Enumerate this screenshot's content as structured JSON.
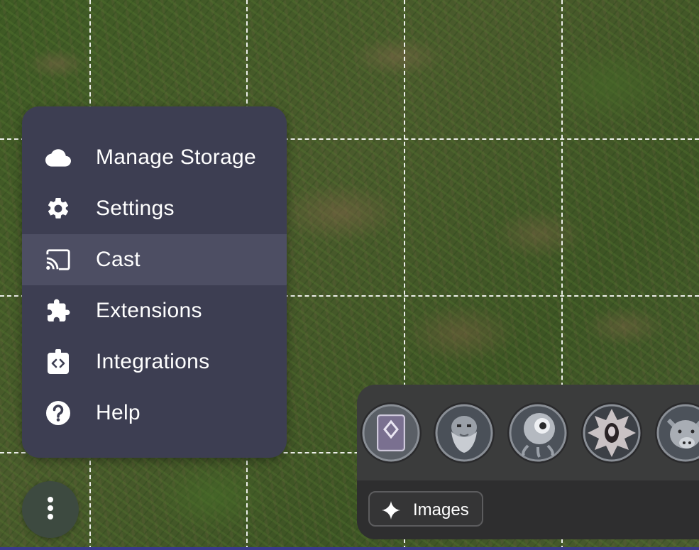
{
  "menu": {
    "items": [
      {
        "label": "Manage Storage",
        "icon": "cloud-icon",
        "active": false
      },
      {
        "label": "Settings",
        "icon": "gear-icon",
        "active": false
      },
      {
        "label": "Cast",
        "icon": "cast-icon",
        "active": true
      },
      {
        "label": "Extensions",
        "icon": "puzzle-piece-icon",
        "active": false
      },
      {
        "label": "Integrations",
        "icon": "integrations-icon",
        "active": false
      },
      {
        "label": "Help",
        "icon": "help-circle-icon",
        "active": false
      }
    ]
  },
  "fab": {
    "icon": "more-vertical-icon"
  },
  "tray": {
    "tokens": [
      {
        "icon": "spellbook-token"
      },
      {
        "icon": "dwarf-token"
      },
      {
        "icon": "eyeball-creature-token"
      },
      {
        "icon": "spiked-helm-token"
      },
      {
        "icon": "boar-token"
      }
    ],
    "images_label": "Images",
    "images_icon": "sparkle-icon"
  },
  "colors": {
    "menu_bg": "#3d3e52",
    "menu_active_bg": "#4d4e63",
    "tray_bg": "#3b3c3c",
    "grid_line": "#ffffff"
  }
}
